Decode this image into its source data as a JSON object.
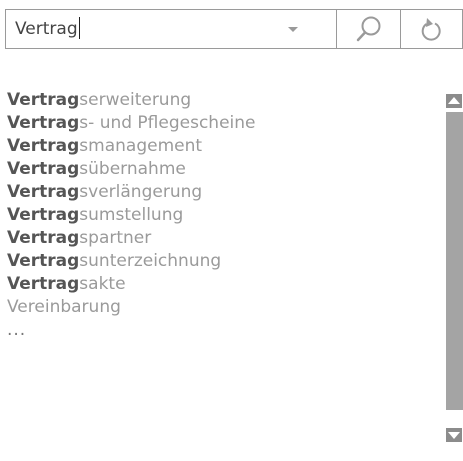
{
  "search": {
    "value": "Vertrag"
  },
  "suggestions": [
    {
      "match": "Vertrag",
      "rest": "serweiterung"
    },
    {
      "match": "Vertrag",
      "rest": "s- und Pflegescheine"
    },
    {
      "match": "Vertrag",
      "rest": "smanagement"
    },
    {
      "match": "Vertrag",
      "rest": "sübernahme"
    },
    {
      "match": "Vertrag",
      "rest": "sverlängerung"
    },
    {
      "match": "Vertrag",
      "rest": "sumstellung"
    },
    {
      "match": "Vertrag",
      "rest": "spartner"
    },
    {
      "match": "Vertrag",
      "rest": "sunterzeichnung"
    },
    {
      "match": "Vertrag",
      "rest": "sakte"
    }
  ],
  "other_suggestion": "Vereinbarung",
  "more_indicator": "...",
  "icons": {
    "dropdown": "chevron-down-icon",
    "search": "search-icon",
    "reset": "reset-icon",
    "scroll_up": "arrow-up-icon",
    "scroll_down": "arrow-down-icon"
  },
  "colors": {
    "border": "#9a9a9a",
    "match_text": "#555555",
    "rest_text": "#9a9a9a",
    "scrollbar": "#a4a4a4"
  }
}
